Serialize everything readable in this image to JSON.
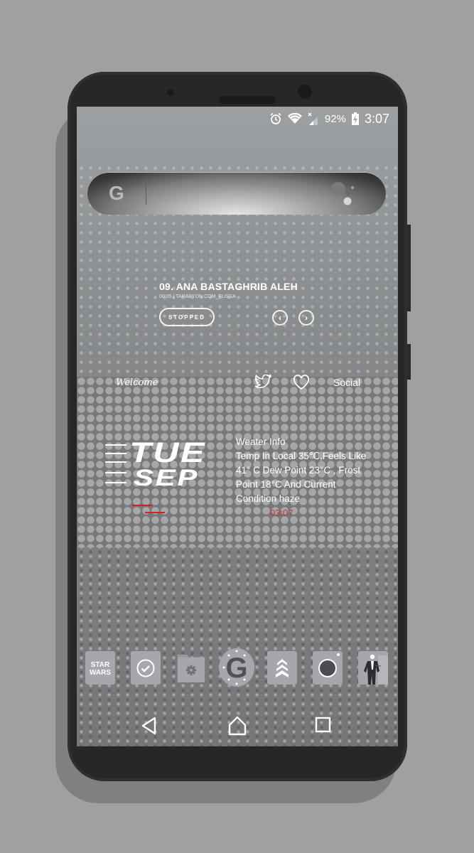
{
  "status_bar": {
    "icons": [
      "alarm-icon",
      "wifi-icon",
      "no-signal-icon",
      "battery-charging-icon"
    ],
    "battery": "92%",
    "time": "3:07"
  },
  "search_bar": {
    "logo": "G",
    "assistant_icon": "google-assistant-icon"
  },
  "music_widget": {
    "title": "09. ANA BASTAGHRIB ALEH",
    "subtitle": "00:05 | TARABYON.COM_ELISSA",
    "state_label": "STOPPED",
    "prev_icon": "‹",
    "next_icon": "›"
  },
  "social_row": {
    "welcome": "Welcome",
    "twitter_icon": "twitter-icon",
    "heart_icon": "heart-icon",
    "social_label": "Social"
  },
  "date_widget": {
    "day": "TUE",
    "month": "SEP",
    "accent_color": "#d02020"
  },
  "weather_widget": {
    "heading": "Weater Info",
    "lines": [
      "Temp In Local 35℃,Feels Like",
      "41° C Dew Point 23°C , Frost",
      "Point 18°C And Current",
      "Condition haze"
    ],
    "clock": "03:07",
    "clock_color": "#c5393a"
  },
  "dock": {
    "apps": [
      {
        "name": "star-wars",
        "label": "STAR WARS"
      },
      {
        "name": "tasks",
        "label": ""
      },
      {
        "name": "files-settings",
        "label": ""
      },
      {
        "name": "google",
        "label": "G"
      },
      {
        "name": "chevrons",
        "label": ""
      },
      {
        "name": "camera",
        "label": ""
      },
      {
        "name": "character",
        "label": ""
      }
    ]
  },
  "nav_bar": {
    "back": "back-icon",
    "home": "home-icon",
    "recents": "recents-icon"
  }
}
